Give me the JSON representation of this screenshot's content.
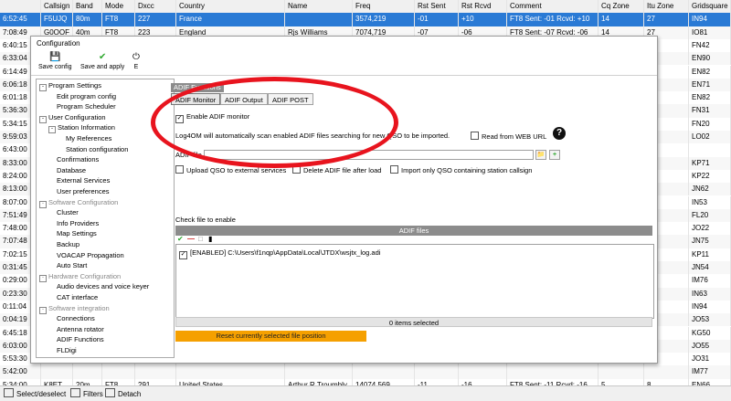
{
  "grid": {
    "columns": [
      "Callsign",
      "Band",
      "Mode",
      "Dxcc",
      "Country",
      "Name",
      "Freq",
      "Rst Sent",
      "Rst Rcvd",
      "Comment",
      "Cq Zone",
      "Itu Zone",
      "Gridsquare"
    ],
    "rows": [
      [
        "6:52:45",
        "F5UJQ",
        "80m",
        "FT8",
        "227",
        "France",
        "",
        "3574,219",
        "-01",
        "+10",
        "FT8  Sent: -01  Rcvd: +10",
        "14",
        "27",
        "IN94"
      ],
      [
        "7:08:49",
        "G0OOF",
        "40m",
        "FT8",
        "223",
        "England",
        "Rjs Williams",
        "7074,719",
        "-07",
        "-06",
        "FT8  Sent: -07  Rcvd: -06",
        "14",
        "27",
        "IO81"
      ],
      [
        "6:40:15",
        "",
        "",
        "",
        "",
        "",
        "",
        "",
        "",
        "",
        "",
        "",
        "",
        "FN42"
      ],
      [
        "6:33:04",
        "",
        "",
        "",
        "",
        "",
        "",
        "",
        "",
        "",
        "",
        "",
        "",
        "EN90"
      ],
      [
        "6:14:49",
        "",
        "",
        "",
        "",
        "",
        "",
        "",
        "",
        "",
        "",
        "",
        "",
        "EN82"
      ],
      [
        "6:06:18",
        "",
        "",
        "",
        "",
        "",
        "",
        "",
        "",
        "",
        "",
        "",
        "",
        "EN71"
      ],
      [
        "6:01:18",
        "",
        "",
        "",
        "",
        "",
        "",
        "",
        "",
        "",
        "",
        "",
        "",
        "EN82"
      ],
      [
        "5:36:30",
        "",
        "",
        "",
        "",
        "",
        "",
        "",
        "",
        "",
        "",
        "",
        "",
        "FN31"
      ],
      [
        "5:34:15",
        "",
        "",
        "",
        "",
        "",
        "",
        "",
        "",
        "",
        "",
        "",
        "",
        "FN20"
      ],
      [
        "9:59:03",
        "",
        "",
        "",
        "",
        "",
        "",
        "",
        "",
        "",
        "",
        "",
        "",
        "LO02"
      ],
      [
        "6:43:00",
        "",
        "",
        "",
        "",
        "",
        "",
        "",
        "",
        "",
        "",
        "",
        "",
        ""
      ],
      [
        "8:33:00",
        "",
        "",
        "",
        "",
        "",
        "",
        "",
        "",
        "",
        "",
        "",
        "",
        "KP71"
      ],
      [
        "8:24:00",
        "",
        "",
        "",
        "",
        "",
        "",
        "",
        "",
        "",
        "",
        "",
        "",
        "KP22"
      ],
      [
        "8:13:00",
        "",
        "",
        "",
        "",
        "",
        "",
        "",
        "",
        "",
        "",
        "",
        "",
        "JN62"
      ],
      [
        "8:07:00",
        "",
        "",
        "",
        "",
        "",
        "",
        "",
        "",
        "",
        "",
        "",
        "",
        "IN53"
      ],
      [
        "7:51:49",
        "",
        "",
        "",
        "",
        "",
        "",
        "",
        "",
        "",
        "",
        "",
        "",
        "FL20"
      ],
      [
        "7:48:00",
        "",
        "",
        "",
        "",
        "",
        "",
        "",
        "",
        "",
        "",
        "",
        "",
        "JO22"
      ],
      [
        "7:07:48",
        "",
        "",
        "",
        "",
        "",
        "",
        "",
        "",
        "",
        "",
        "",
        "",
        "JN75"
      ],
      [
        "7:02:15",
        "",
        "",
        "",
        "",
        "",
        "",
        "",
        "",
        "",
        "",
        "",
        "",
        "KP11"
      ],
      [
        "0:31:45",
        "",
        "",
        "",
        "",
        "",
        "",
        "",
        "",
        "",
        "",
        "",
        "",
        "JN54"
      ],
      [
        "0:29:00",
        "",
        "",
        "",
        "",
        "",
        "",
        "",
        "",
        "",
        "",
        "",
        "",
        "IM76"
      ],
      [
        "0:23:30",
        "",
        "",
        "",
        "",
        "",
        "",
        "",
        "",
        "",
        "",
        "",
        "",
        "IN63"
      ],
      [
        "0:11:04",
        "",
        "",
        "",
        "",
        "",
        "",
        "",
        "",
        "",
        "",
        "",
        "",
        "IN94"
      ],
      [
        "0:04:19",
        "",
        "",
        "",
        "",
        "",
        "",
        "",
        "",
        "",
        "",
        "",
        "",
        "JO53"
      ],
      [
        "6:45:18",
        "",
        "",
        "",
        "",
        "",
        "",
        "",
        "",
        "",
        "",
        "",
        "",
        "KG50"
      ],
      [
        "6:03:00",
        "",
        "",
        "",
        "",
        "",
        "",
        "",
        "",
        "",
        "",
        "",
        "",
        "JO55"
      ],
      [
        "5:53:30",
        "",
        "",
        "",
        "",
        "",
        "",
        "",
        "",
        "",
        "",
        "",
        "",
        "JO31"
      ],
      [
        "5:42:00",
        "",
        "",
        "",
        "",
        "",
        "",
        "",
        "",
        "",
        "",
        "",
        "",
        "IM77"
      ],
      [
        "5:34:00",
        "K8ET",
        "20m",
        "FT8",
        "291",
        "United States",
        "Arthur R Troumbly",
        "14074,569",
        "-11",
        "-16",
        "FT8  Sent: -11  Rcvd: -16",
        "5",
        "8",
        "EN66"
      ],
      [
        "5:14:00",
        "OK1FMG",
        "20m",
        "FT8",
        "503",
        "Czech Republic",
        "Vitezslav Hoffmann",
        "14075,305",
        "-06",
        "+02",
        "FT8  Sent: -06  Rcvd: +02",
        "15",
        "28",
        "JO60"
      ]
    ]
  },
  "statusbar": {
    "select_label": "Select/deselect",
    "filters_label": "Filters",
    "detach_label": "Detach"
  },
  "dialog": {
    "title": "Configuration",
    "toolbar": {
      "save_config": "Save config",
      "save_apply": "Save and apply",
      "exit": "E"
    },
    "tree": [
      {
        "label": "Program Settings",
        "level": 0,
        "expander": "-",
        "grey": false
      },
      {
        "label": "Edit program config",
        "level": 2,
        "grey": false
      },
      {
        "label": "Program Scheduler",
        "level": 2,
        "grey": false
      },
      {
        "label": "User Configuration",
        "level": 0,
        "expander": "-",
        "grey": false
      },
      {
        "label": "Station Information",
        "level": 1,
        "expander": "-",
        "grey": false
      },
      {
        "label": "My References",
        "level": 3,
        "grey": false
      },
      {
        "label": "Station configuration",
        "level": 3,
        "grey": false
      },
      {
        "label": "Confirmations",
        "level": 2,
        "grey": false
      },
      {
        "label": "Database",
        "level": 2,
        "grey": false
      },
      {
        "label": "External Services",
        "level": 2,
        "grey": false
      },
      {
        "label": "User preferences",
        "level": 2,
        "grey": false
      },
      {
        "label": "Software Configuration",
        "level": 0,
        "expander": "-",
        "grey": true
      },
      {
        "label": "Cluster",
        "level": 2,
        "grey": false
      },
      {
        "label": "Info Providers",
        "level": 2,
        "grey": false
      },
      {
        "label": "Map Settings",
        "level": 2,
        "grey": false
      },
      {
        "label": "Backup",
        "level": 2,
        "grey": false
      },
      {
        "label": "VOACAP Propagation",
        "level": 2,
        "grey": false
      },
      {
        "label": "Auto Start",
        "level": 2,
        "grey": false
      },
      {
        "label": "Hardware Configuration",
        "level": 0,
        "expander": "-",
        "grey": true
      },
      {
        "label": "Audio devices and voice keyer",
        "level": 2,
        "grey": false
      },
      {
        "label": "CAT interface",
        "level": 2,
        "grey": false
      },
      {
        "label": "Software integration",
        "level": 0,
        "expander": "-",
        "grey": true
      },
      {
        "label": "Connections",
        "level": 2,
        "grey": false
      },
      {
        "label": "Antenna rotator",
        "level": 2,
        "grey": false
      },
      {
        "label": "ADIF Functions",
        "level": 2,
        "grey": false
      },
      {
        "label": "FLDigi",
        "level": 2,
        "grey": false
      }
    ],
    "panel": {
      "group_label": "ADIF Functions",
      "tabs": [
        "ADIF Monitor",
        "ADIF Output",
        "ADIF POST"
      ],
      "enable_label": "Enable ADIF monitor",
      "info_text": "Log4OM will automatically scan enabled ADIF files searching for new QSO to be imported.",
      "read_web_label": "Read from WEB URL",
      "adif_file_label": "ADIF file",
      "upload_label": "Upload QSO to external services",
      "delete_label": "Delete ADIF file after load",
      "import_label": "Import only QSO containing station callsign",
      "check_label": "Check file to enable",
      "files_header": "ADIF files",
      "file_entry": "[ENABLED] C:\\Users\\f1nqp\\AppData\\Local\\JTDX\\wsjtx_log.adi",
      "items_selected": "0 items selected",
      "reset_button": "Reset currently selected file position"
    }
  },
  "annotation": {
    "color": "#e8141e"
  },
  "colors": {
    "selection": "#2a7ad5",
    "orange_button": "#f5a000",
    "add_icon": "#2fa82f"
  }
}
